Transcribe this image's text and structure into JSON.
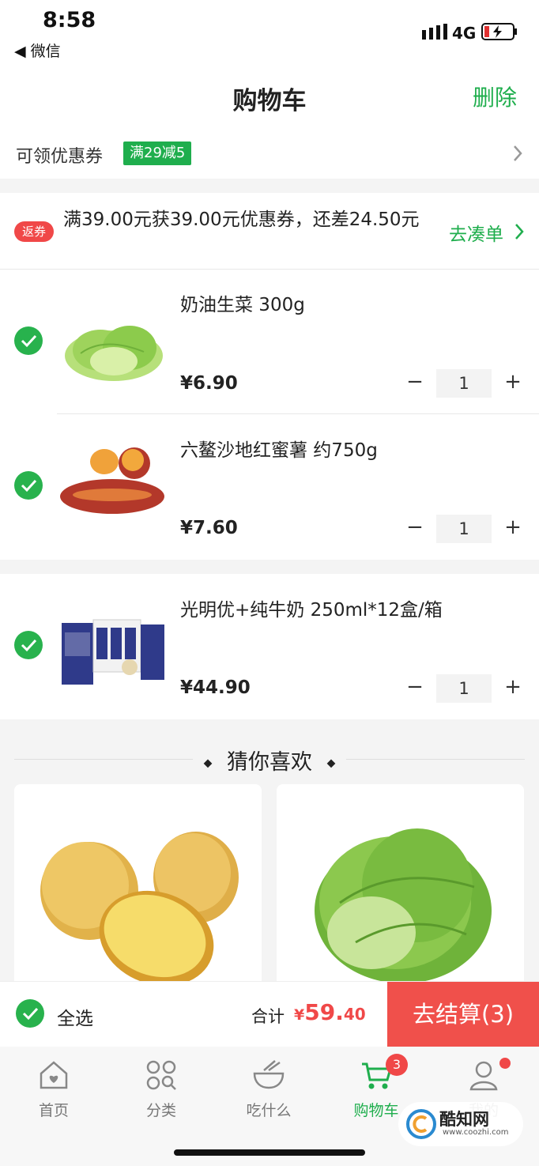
{
  "status_bar": {
    "time": "8:58",
    "back_app": "◀ 微信",
    "network": "4G"
  },
  "header": {
    "title": "购物车",
    "delete_label": "删除"
  },
  "coupon": {
    "label": "可领优惠券",
    "tag": "满29减5"
  },
  "promo": {
    "badge": "返券",
    "text": "满39.00元获39.00元优惠券，还差24.50元",
    "link": "去凑单"
  },
  "cart_items": [
    {
      "name": "奶油生菜 300g",
      "price": "¥6.90",
      "qty": "1"
    },
    {
      "name": "六鳌沙地红蜜薯 约750g",
      "price": "¥7.60",
      "qty": "1"
    },
    {
      "name": "光明优+纯牛奶 250ml*12盒/箱",
      "price": "¥44.90",
      "qty": "1"
    }
  ],
  "recommendations": {
    "title": "猜你喜欢"
  },
  "checkout": {
    "select_all": "全选",
    "total_label": "合计",
    "currency": "¥",
    "total_int": "59.",
    "total_dec": "40",
    "button": "去结算(3)"
  },
  "tabs": [
    {
      "label": "首页",
      "icon": "home-icon"
    },
    {
      "label": "分类",
      "icon": "category-icon"
    },
    {
      "label": "吃什么",
      "icon": "bowl-icon"
    },
    {
      "label": "购物车",
      "icon": "cart-icon"
    },
    {
      "label": "我的",
      "icon": "profile-icon"
    }
  ],
  "cart_badge": "3",
  "watermark": {
    "name": "酷知网",
    "url": "www.coozhi.com"
  },
  "colors": {
    "accent_green": "#1fae4d",
    "accent_red": "#f04848",
    "checkout_red": "#f0504b"
  }
}
